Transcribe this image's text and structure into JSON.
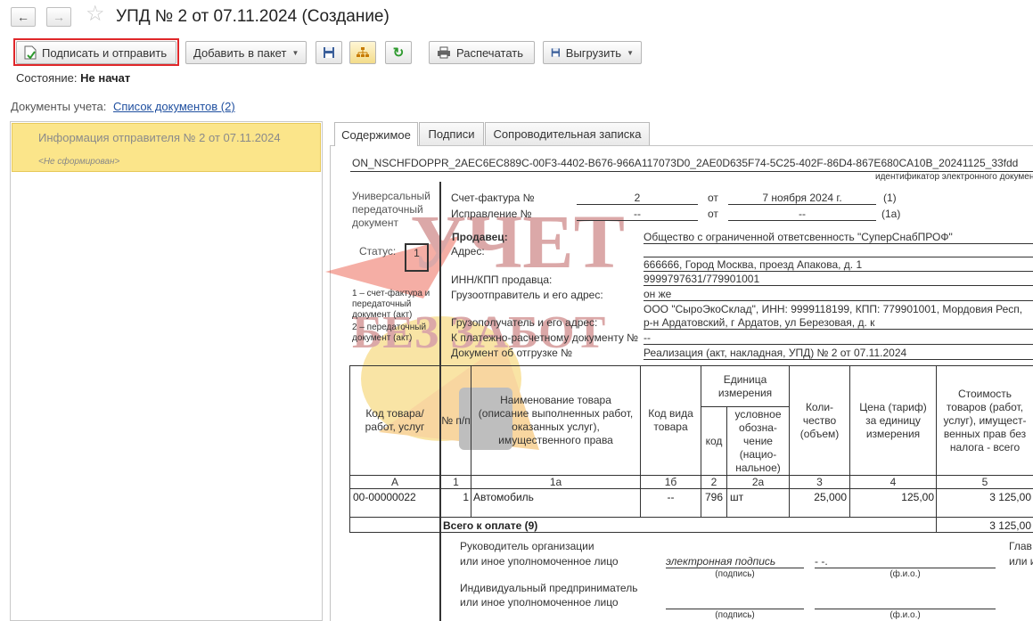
{
  "window": {
    "title": "УПД № 2 от 07.11.2024 (Создание)"
  },
  "toolbar": {
    "sign_send": "Подписать и отправить",
    "add_package": "Добавить в пакет",
    "print": "Распечатать",
    "export": "Выгрузить"
  },
  "status": {
    "label": "Состояние:",
    "value": "Не начат"
  },
  "docs": {
    "label": "Документы учета:",
    "link": "Список документов (2)"
  },
  "left_list": {
    "item_title": "Информация отправителя № 2 от 07.11.2024",
    "item_sub": "<Не сформирован>"
  },
  "tabs": [
    "Содержимое",
    "Подписи",
    "Сопроводительная записка"
  ],
  "doc": {
    "file_id": "ON_NSCHFDOPPR_2AEC6EC889C-00F3-4402-B676-966A117073D0_2AE0D635F74-5C25-402F-86D4-867E680CA10B_20241125_33fdd",
    "file_id_caption": "идентификатор электронного документа",
    "upd_l1": "Универсальный",
    "upd_l2": "передаточный",
    "upd_l3": "документ",
    "status_label": "Статус:",
    "status_value": "1",
    "status_note_1": "1 – счет-фактура и",
    "status_note_2": "передаточный",
    "status_note_3": "документ (акт)",
    "status_note_4": "2 – передаточный",
    "status_note_5": "документ (акт)",
    "invoice_label": "Счет-фактура №",
    "invoice_no": "2",
    "ot": "от",
    "invoice_date": "7 ноября 2024 г.",
    "n1": "(1)",
    "correction_label": "Исправление №",
    "correction_no": "--",
    "correction_date": "--",
    "n1a": "(1а)",
    "seller_label": "Продавец:",
    "seller_value": "Общество с ограниченной ответсвенность \"СуперСнабПРОФ\"",
    "address_label": "Адрес:",
    "address_value": "666666, Город Москва, проезд Апакова, д. 1",
    "inn_label": "ИНН/КПП продавца:",
    "inn_value": "9999797631/779901001",
    "shipper_label": "Грузоотправитель и его адрес:",
    "shipper_value": "он же",
    "consignee_label": "Грузополучатель и его адрес:",
    "consignee_value_1": "ООО \"СыроЭкоСклад\", ИНН: 9999118199, КПП: 779901001, Мордовия Респ,",
    "consignee_value_2": "р-н Ардатовский, г Ардатов, ул Березовая, д. к",
    "payment_label": "К платежно-расчетному документу №",
    "payment_value": "--",
    "shipment_label": "Документ об отгрузке №",
    "shipment_value": "Реализация (акт, накладная, УПД) № 2 от 07.11.2024"
  },
  "table": {
    "headers": {
      "code": "Код товара/ работ, услуг",
      "num": "№ п/п",
      "name": "Наименование товара (описание выполненных работ, оказанных услуг), имущественного права",
      "kind": "Код вида товара",
      "unit": "Единица измерения",
      "unit_code": "код",
      "unit_name": "условное обозна-чение (нацио-нальное)",
      "qty": "Коли-чество (объем)",
      "price": "Цена (тариф) за единицу измерения",
      "cost": "Стоимость товаров (работ, услуг), имущест-венных прав без налога - всего"
    },
    "col_codes": [
      "А",
      "1",
      "1а",
      "1б",
      "2",
      "2а",
      "3",
      "4",
      "5"
    ],
    "row": {
      "code": "00-00000022",
      "num": "1",
      "name": "Автомобиль",
      "kind": "--",
      "unit_code": "796",
      "unit_name": "шт",
      "qty": "25,000",
      "price": "125,00",
      "cost": "3 125,00"
    },
    "total_label": "Всего к оплате (9)",
    "total_value": "3 125,00"
  },
  "signatures": {
    "head_1": "Руководитель организации",
    "head_2": "или иное уполномоченное лицо",
    "esign": "электронная подпись",
    "dash": "- -.",
    "sub_sign": "(подпись)",
    "sub_fio": "(ф.и.о.)",
    "chief_1": "Глав",
    "chief_2": "или и",
    "ip_1": "Индивидуальный предприниматель",
    "ip_2": "или иное уполномоченное лицо"
  },
  "watermark_text": {
    "l1": "УЧЕТ",
    "l2": "БЕЗ ЗАБОТ"
  },
  "colors": {
    "highlight": "#fbe58a",
    "accent_red": "#e0272a",
    "link": "#1f4f9f"
  }
}
